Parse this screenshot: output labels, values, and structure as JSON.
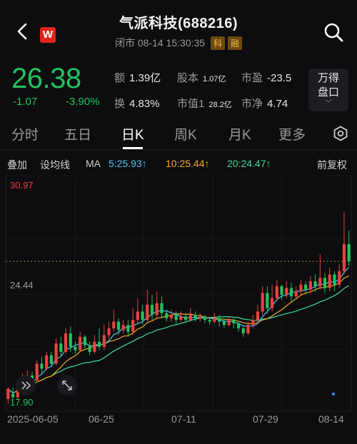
{
  "header": {
    "title": "气派科技(688216)",
    "status": "闭市",
    "datetime": "08-14 15:30:35",
    "tags": [
      "科",
      "融"
    ],
    "app_logo": "W"
  },
  "quote": {
    "price": "26.38",
    "change": "-1.07",
    "change_pct": "-3.90%",
    "color_down": "#21c25e",
    "stats": [
      {
        "key": "额",
        "value": "1.39亿"
      },
      {
        "key": "股本",
        "value": "1.07亿"
      },
      {
        "key": "市盈",
        "value": "-23.5"
      },
      {
        "key": "换",
        "value": "4.83%"
      },
      {
        "key": "市值1",
        "value": "28.2亿"
      },
      {
        "key": "市净",
        "value": "4.74"
      }
    ],
    "wan_button": [
      "万得",
      "盘口"
    ]
  },
  "tabs": {
    "items": [
      "分时",
      "五日",
      "日K",
      "周K",
      "月K",
      "更多"
    ],
    "active_index": 2
  },
  "ma_bar": {
    "overlay": "叠加",
    "set_ma": "设均线",
    "ma": "MA",
    "ma5": "5:25.93↑",
    "ma10": "10:25.44↑",
    "ma20": "20:24.47↑",
    "adjust": "前复权",
    "colors": {
      "ma5": "#4fc3f7",
      "ma10": "#f5a623",
      "ma20": "#3ddc97"
    }
  },
  "chart_data": {
    "type": "candlestick",
    "y_labels": {
      "high": "30.97",
      "mid": "24.44",
      "low": "17.90"
    },
    "ylim": [
      17.9,
      30.97
    ],
    "last_close_line": 26.38,
    "x_ticks": [
      "2025-06-05",
      "06-25",
      "07-11",
      "07-29",
      "08-14"
    ],
    "up_color": "#e8433f",
    "down_color": "#21c25e",
    "candles": [
      [
        18.2,
        18.8,
        17.9,
        18.9
      ],
      [
        18.5,
        18.3,
        18.1,
        18.9
      ],
      [
        18.3,
        19.0,
        18.2,
        19.2
      ],
      [
        19.0,
        19.2,
        18.8,
        19.7
      ],
      [
        19.2,
        19.6,
        19.0,
        19.9
      ],
      [
        19.6,
        19.3,
        19.1,
        19.8
      ],
      [
        19.3,
        20.3,
        19.2,
        20.5
      ],
      [
        20.3,
        20.0,
        19.7,
        20.7
      ],
      [
        20.0,
        20.8,
        19.9,
        21.0
      ],
      [
        20.8,
        20.3,
        20.1,
        21.0
      ],
      [
        20.3,
        21.5,
        20.2,
        21.8
      ],
      [
        21.5,
        21.0,
        20.7,
        21.9
      ],
      [
        21.0,
        22.1,
        20.9,
        22.4
      ],
      [
        22.1,
        21.3,
        21.0,
        22.5
      ],
      [
        21.3,
        21.1,
        20.9,
        21.6
      ],
      [
        21.1,
        21.9,
        21.0,
        22.2
      ],
      [
        21.9,
        21.4,
        21.2,
        22.0
      ],
      [
        21.4,
        21.0,
        20.8,
        21.6
      ],
      [
        21.0,
        21.6,
        20.9,
        22.0
      ],
      [
        21.6,
        21.3,
        21.1,
        22.4
      ],
      [
        21.3,
        22.0,
        21.1,
        22.6
      ],
      [
        22.0,
        22.4,
        21.8,
        22.8
      ],
      [
        22.4,
        22.8,
        22.2,
        23.5
      ],
      [
        22.8,
        22.3,
        22.0,
        23.0
      ],
      [
        22.3,
        22.6,
        22.1,
        22.9
      ],
      [
        22.6,
        22.2,
        21.9,
        22.9
      ],
      [
        22.2,
        22.9,
        22.0,
        23.6
      ],
      [
        22.9,
        23.4,
        22.7,
        24.2
      ],
      [
        23.4,
        22.9,
        22.6,
        23.8
      ],
      [
        22.9,
        23.8,
        22.8,
        24.7
      ],
      [
        23.8,
        23.2,
        22.9,
        24.4
      ],
      [
        23.2,
        23.9,
        23.0,
        24.6
      ],
      [
        23.9,
        23.3,
        23.0,
        24.3
      ],
      [
        23.3,
        23.0,
        22.8,
        23.5
      ],
      [
        23.0,
        23.2,
        22.8,
        23.5
      ],
      [
        23.2,
        22.9,
        22.6,
        23.4
      ],
      [
        22.9,
        23.1,
        22.8,
        23.4
      ],
      [
        23.1,
        22.9,
        22.7,
        23.3
      ],
      [
        22.9,
        23.2,
        22.8,
        23.6
      ],
      [
        23.2,
        23.0,
        22.8,
        23.4
      ],
      [
        23.0,
        23.1,
        22.8,
        23.3
      ],
      [
        23.1,
        22.9,
        22.7,
        23.2
      ],
      [
        22.9,
        22.8,
        22.6,
        23.1
      ],
      [
        22.8,
        23.0,
        22.7,
        23.3
      ],
      [
        23.0,
        22.8,
        22.5,
        23.2
      ],
      [
        22.8,
        22.6,
        22.4,
        23.0
      ],
      [
        22.6,
        22.9,
        22.5,
        23.1
      ],
      [
        22.9,
        22.7,
        22.4,
        23.0
      ],
      [
        22.7,
        22.4,
        22.2,
        22.8
      ],
      [
        22.4,
        22.1,
        21.9,
        22.6
      ],
      [
        22.1,
        22.6,
        22.0,
        22.8
      ],
      [
        22.6,
        22.9,
        22.4,
        23.2
      ],
      [
        22.9,
        23.4,
        22.7,
        23.8
      ],
      [
        23.4,
        24.5,
        23.2,
        24.9
      ],
      [
        24.5,
        23.6,
        23.3,
        24.9
      ],
      [
        23.6,
        24.2,
        23.4,
        25.0
      ],
      [
        24.2,
        24.9,
        24.0,
        25.3
      ],
      [
        24.9,
        24.4,
        24.1,
        25.0
      ],
      [
        24.4,
        24.8,
        24.2,
        25.2
      ],
      [
        24.8,
        24.3,
        24.0,
        25.1
      ],
      [
        24.3,
        24.6,
        24.1,
        24.9
      ],
      [
        24.6,
        25.0,
        24.4,
        25.3
      ],
      [
        25.0,
        24.7,
        24.4,
        25.2
      ],
      [
        24.7,
        25.2,
        24.5,
        25.5
      ],
      [
        25.2,
        24.9,
        24.6,
        25.6
      ],
      [
        24.9,
        25.4,
        24.7,
        26.8
      ],
      [
        25.4,
        24.8,
        24.5,
        25.7
      ],
      [
        24.8,
        25.6,
        24.6,
        26.0
      ],
      [
        25.6,
        25.0,
        24.6,
        25.8
      ],
      [
        25.0,
        25.8,
        24.8,
        26.2
      ],
      [
        25.8,
        27.4,
        25.6,
        29.3
      ],
      [
        27.4,
        26.38,
        26.1,
        28.2
      ]
    ]
  }
}
